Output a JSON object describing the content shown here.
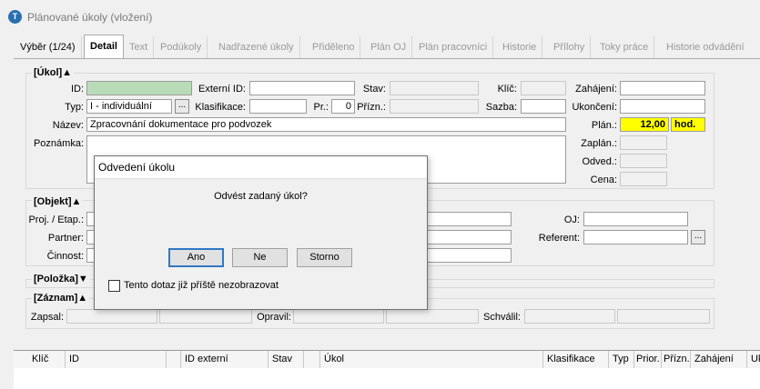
{
  "window": {
    "title": "Plánované úkoly (vložení)",
    "icon": "app-logo-icon"
  },
  "tabs": [
    {
      "label": "Výběr (1/24)"
    },
    {
      "label": "Detail"
    },
    {
      "label": "Text"
    },
    {
      "label": "Podúkoly"
    },
    {
      "label": "Nadřazené úkoly"
    },
    {
      "label": "Přiděleno"
    },
    {
      "label": "Plán OJ"
    },
    {
      "label": "Plán pracovníci"
    },
    {
      "label": "Historie"
    },
    {
      "label": "Přílohy"
    },
    {
      "label": "Toky práce"
    },
    {
      "label": "Historie odvádění"
    }
  ],
  "ukol": {
    "title": "[Úkol]▲",
    "id_label": "ID:",
    "id_value": "",
    "externi_id_label": "Externí ID:",
    "externi_id_value": "",
    "stav_label": "Stav:",
    "stav_value": "",
    "klic_label": "Klíč:",
    "klic_value": "",
    "zahajeni_label": "Zahájení:",
    "zahajeni_value": "",
    "typ_label": "Typ:",
    "typ_value": "I - individuální",
    "klasifikace_label": "Klasifikace:",
    "klasifikace_value": "",
    "pr_label": "Pr.:",
    "pr_value": "0",
    "priznaky_label": "Přízn.:",
    "priznaky_value": "",
    "sazba_label": "Sazba:",
    "sazba_value": "",
    "ukonceni_label": "Ukončení:",
    "ukonceni_value": "",
    "nazev_label": "Název:",
    "nazev_value": "Zpracovnání dokumentace pro podvozek",
    "plan_label": "Plán.:",
    "plan_value": "12,00",
    "plan_unit": "hod.",
    "poznamka_label": "Poznámka:",
    "zaplan_label": "Zaplán.:",
    "odved_label": "Odved.:",
    "cena_label": "Cena:",
    "ellipsis": "..."
  },
  "objekt": {
    "title": "[Objekt]▲",
    "proj_label": "Proj. / Etap.:",
    "partner_label": "Partner:",
    "cinnost_label": "Činnost:",
    "oj_label": "OJ:",
    "referent_label": "Referent:",
    "ellipsis": "..."
  },
  "polozka": {
    "title": "[Položka]▼"
  },
  "zaznam": {
    "title": "[Záznam]▲",
    "zapsal_label": "Zapsal:",
    "opravil_label": "Opravil:",
    "schvalil_label": "Schválil:"
  },
  "grid": {
    "columns": [
      "Klíč",
      "ID",
      "",
      "ID externí",
      "Stav",
      "",
      "Úkol",
      "Klasifikace",
      "Typ",
      "Prior.",
      "Přízn.",
      "Zahájení",
      "Ukon"
    ]
  },
  "dialog": {
    "title": "Odvedení úkolu",
    "message": "Odvést zadaný úkol?",
    "yes": "Ano",
    "no": "Ne",
    "cancel": "Storno",
    "checkbox_label": "Tento dotaz již příště nezobrazovat"
  },
  "colors": {
    "highlight": "#ffff00",
    "id_field": "#b9dcb8",
    "default_button_border": "#2f78c6"
  }
}
